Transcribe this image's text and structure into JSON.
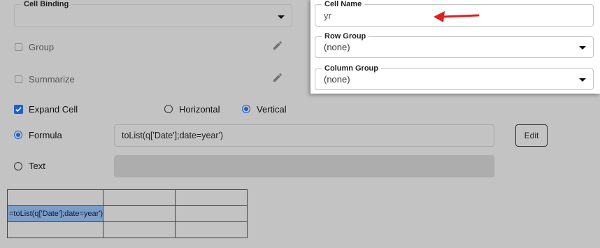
{
  "left": {
    "cell_binding": {
      "label": "Cell Binding",
      "value": ""
    },
    "group": {
      "label": "Group",
      "checked": false
    },
    "summarize": {
      "label": "Summarize",
      "checked": false
    },
    "expand_cell": {
      "label": "Expand Cell",
      "checked": true
    },
    "orientation": {
      "options": [
        "Horizontal",
        "Vertical"
      ],
      "selected": "Vertical"
    },
    "formula": {
      "label": "Formula",
      "selected": true,
      "value": "toList(q['Date'];date=year')"
    },
    "text": {
      "label": "Text",
      "selected": false,
      "value": ""
    },
    "edit_button": "Edit"
  },
  "preview": {
    "selected_cell": "=toList(q['Date'];date=year')"
  },
  "panel": {
    "cell_name": {
      "label": "Cell Name",
      "value": "yr"
    },
    "row_group": {
      "label": "Row Group",
      "value": "(none)"
    },
    "column_group": {
      "label": "Column Group",
      "value": "(none)"
    }
  },
  "colors": {
    "accent": "#1c5fd1",
    "arrow": "#e02020",
    "selected_cell": "#7d9ec6"
  }
}
